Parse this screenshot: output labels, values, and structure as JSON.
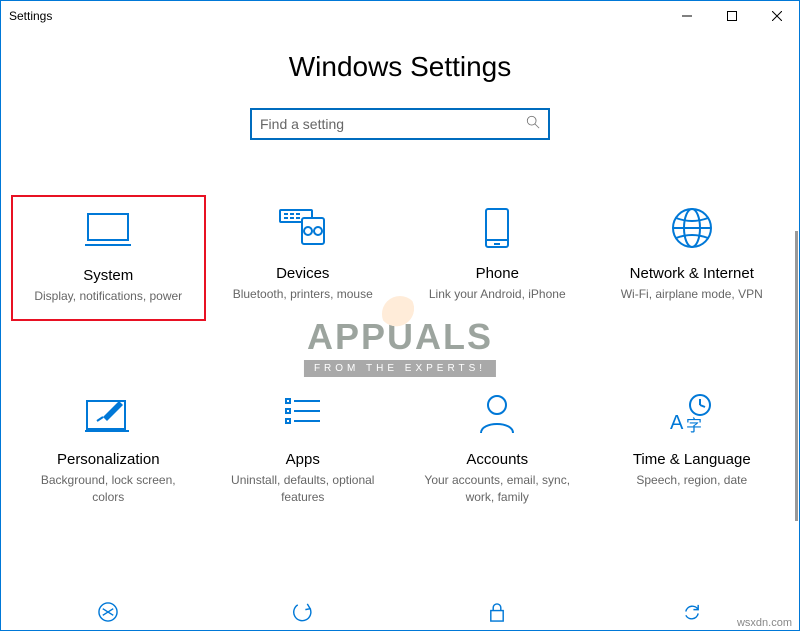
{
  "window": {
    "title": "Settings"
  },
  "header": {
    "title": "Windows Settings"
  },
  "search": {
    "placeholder": "Find a setting"
  },
  "tiles": [
    {
      "title": "System",
      "desc": "Display, notifications, power",
      "highlight": true
    },
    {
      "title": "Devices",
      "desc": "Bluetooth, printers, mouse"
    },
    {
      "title": "Phone",
      "desc": "Link your Android, iPhone"
    },
    {
      "title": "Network & Internet",
      "desc": "Wi-Fi, airplane mode, VPN"
    },
    {
      "title": "Personalization",
      "desc": "Background, lock screen, colors"
    },
    {
      "title": "Apps",
      "desc": "Uninstall, defaults, optional features"
    },
    {
      "title": "Accounts",
      "desc": "Your accounts, email, sync, work, family"
    },
    {
      "title": "Time & Language",
      "desc": "Speech, region, date"
    }
  ],
  "watermark": {
    "main": "APPUALS",
    "sub": "FROM THE EXPERTS!"
  },
  "footer": {
    "url": "wsxdn.com"
  }
}
